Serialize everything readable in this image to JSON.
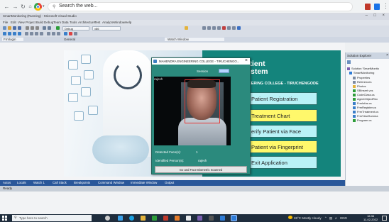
{
  "browser": {
    "address_text": "Search the web...",
    "icons": [
      "back-arrow-icon",
      "forward-arrow-icon",
      "reload-icon",
      "home-icon",
      "chrome-logo-icon",
      "search-icon"
    ]
  },
  "vs": {
    "title": "SmartMonitoring (Running) - Microsoft Visual Studio",
    "menu": [
      "File",
      "Edit",
      "View",
      "Project",
      "Build",
      "Debug",
      "Team",
      "Data",
      "Tools",
      "Architecture",
      "Test",
      "Analyze",
      "Window",
      "Help"
    ],
    "toolbar_debug_label": "Debug",
    "toolbar_cpu_label": "x86",
    "doc_left_label": "Frmlogin",
    "doc_center_label": "General",
    "doc_right_label": "Watch Window"
  },
  "app": {
    "title_line1": "Fingerprint based Patient",
    "title_line2": "Monitoring System",
    "college": "EERING COLLEGE - TIRUCHENGODE",
    "buttons": [
      {
        "label": "Patient Registration",
        "color": "cyan"
      },
      {
        "label": "Treatment Chart",
        "color": "yellow"
      },
      {
        "label": "erify Patient via Face",
        "color": "cyan"
      },
      {
        "label": "Patient via Fingerprint",
        "color": "yellow"
      },
      {
        "label": "Exit Application",
        "color": "cyan"
      }
    ]
  },
  "dialog": {
    "title": "MAHENDRA ENGINEERING COLLEGE - TIRUCHENGO...",
    "session_label": "Session",
    "camera_name": "rajesh",
    "detected_faces_label": "Detected Face(s):",
    "detected_faces_value": "1",
    "identified_label": "Identified Person(s):",
    "identified_value": "rajesh",
    "scan_button": "Go and Face Biometric Scanned"
  },
  "solution_explorer": {
    "header": "Solution Explorer",
    "items": [
      {
        "label": "Solution 'SmartMonito",
        "indent": 0
      },
      {
        "label": "SmartMonitoring",
        "indent": 1
      },
      {
        "label": "Properties",
        "indent": 2
      },
      {
        "label": "References",
        "indent": 2
      },
      {
        "label": "Photos",
        "indent": 2
      },
      {
        "label": "SBInsert.vcs",
        "indent": 2
      },
      {
        "label": "CodeClass.cs",
        "indent": 2
      },
      {
        "label": "AgentObjectRec",
        "indent": 2
      },
      {
        "label": "Frmlofus.cs",
        "indent": 2
      },
      {
        "label": "FrmRegister.cs",
        "indent": 2
      },
      {
        "label": "FrmTreatment.cs",
        "indent": 2
      },
      {
        "label": "FrmViewSumma",
        "indent": 2
      },
      {
        "label": "Program.cs",
        "indent": 2
      }
    ],
    "tab_solution": "Solution...",
    "tab_team": "Team Ex"
  },
  "bottom_tabs": [
    "Autos",
    "Locals",
    "Watch 1",
    "Call Stack",
    "Breakpoints",
    "Command Window",
    "Immediate Window",
    "Output"
  ],
  "status": "Ready",
  "taskbar": {
    "search_placeholder": "Type here to search",
    "tray_text": "26°C  Mostly cloudy",
    "lang": "ENG",
    "time": "16:36",
    "date": "11-02-2022"
  }
}
